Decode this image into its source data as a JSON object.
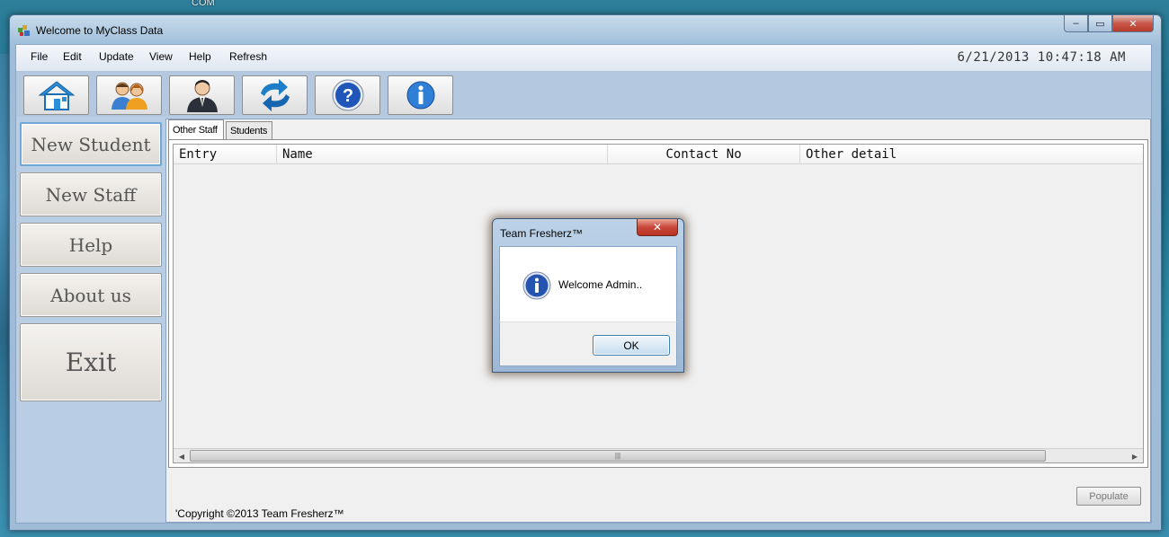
{
  "desktop": {
    "top_text": "COM"
  },
  "window": {
    "title": "Welcome to MyClass Data"
  },
  "menu": [
    "File",
    "Edit",
    "Update",
    "View",
    "Help",
    "Refresh"
  ],
  "datetime": "6/21/2013 10:47:18 AM",
  "toolbar": {
    "icons": [
      "home-icon",
      "users-icon",
      "staff-icon",
      "refresh-icon",
      "help-icon",
      "info-icon"
    ]
  },
  "sidebar": {
    "items": [
      {
        "label": "New Student"
      },
      {
        "label": "New Staff"
      },
      {
        "label": "Help"
      },
      {
        "label": "About us"
      },
      {
        "label": "Exit"
      }
    ]
  },
  "tabs": [
    {
      "label": "Other Staff",
      "active": true
    },
    {
      "label": "Students",
      "active": false
    }
  ],
  "grid": {
    "columns": [
      "Entry",
      "Name",
      "Contact No",
      "Other detail"
    ]
  },
  "populate_label": "Populate",
  "copyright": "'Copyright ©2013 Team Fresherz™",
  "dialog": {
    "title": "Team Fresherz™",
    "message": "Welcome Admin..",
    "ok_label": "OK",
    "close_glyph": "✕"
  },
  "colors": {
    "accent": "#2f74c0",
    "close_red": "#c9473a"
  }
}
